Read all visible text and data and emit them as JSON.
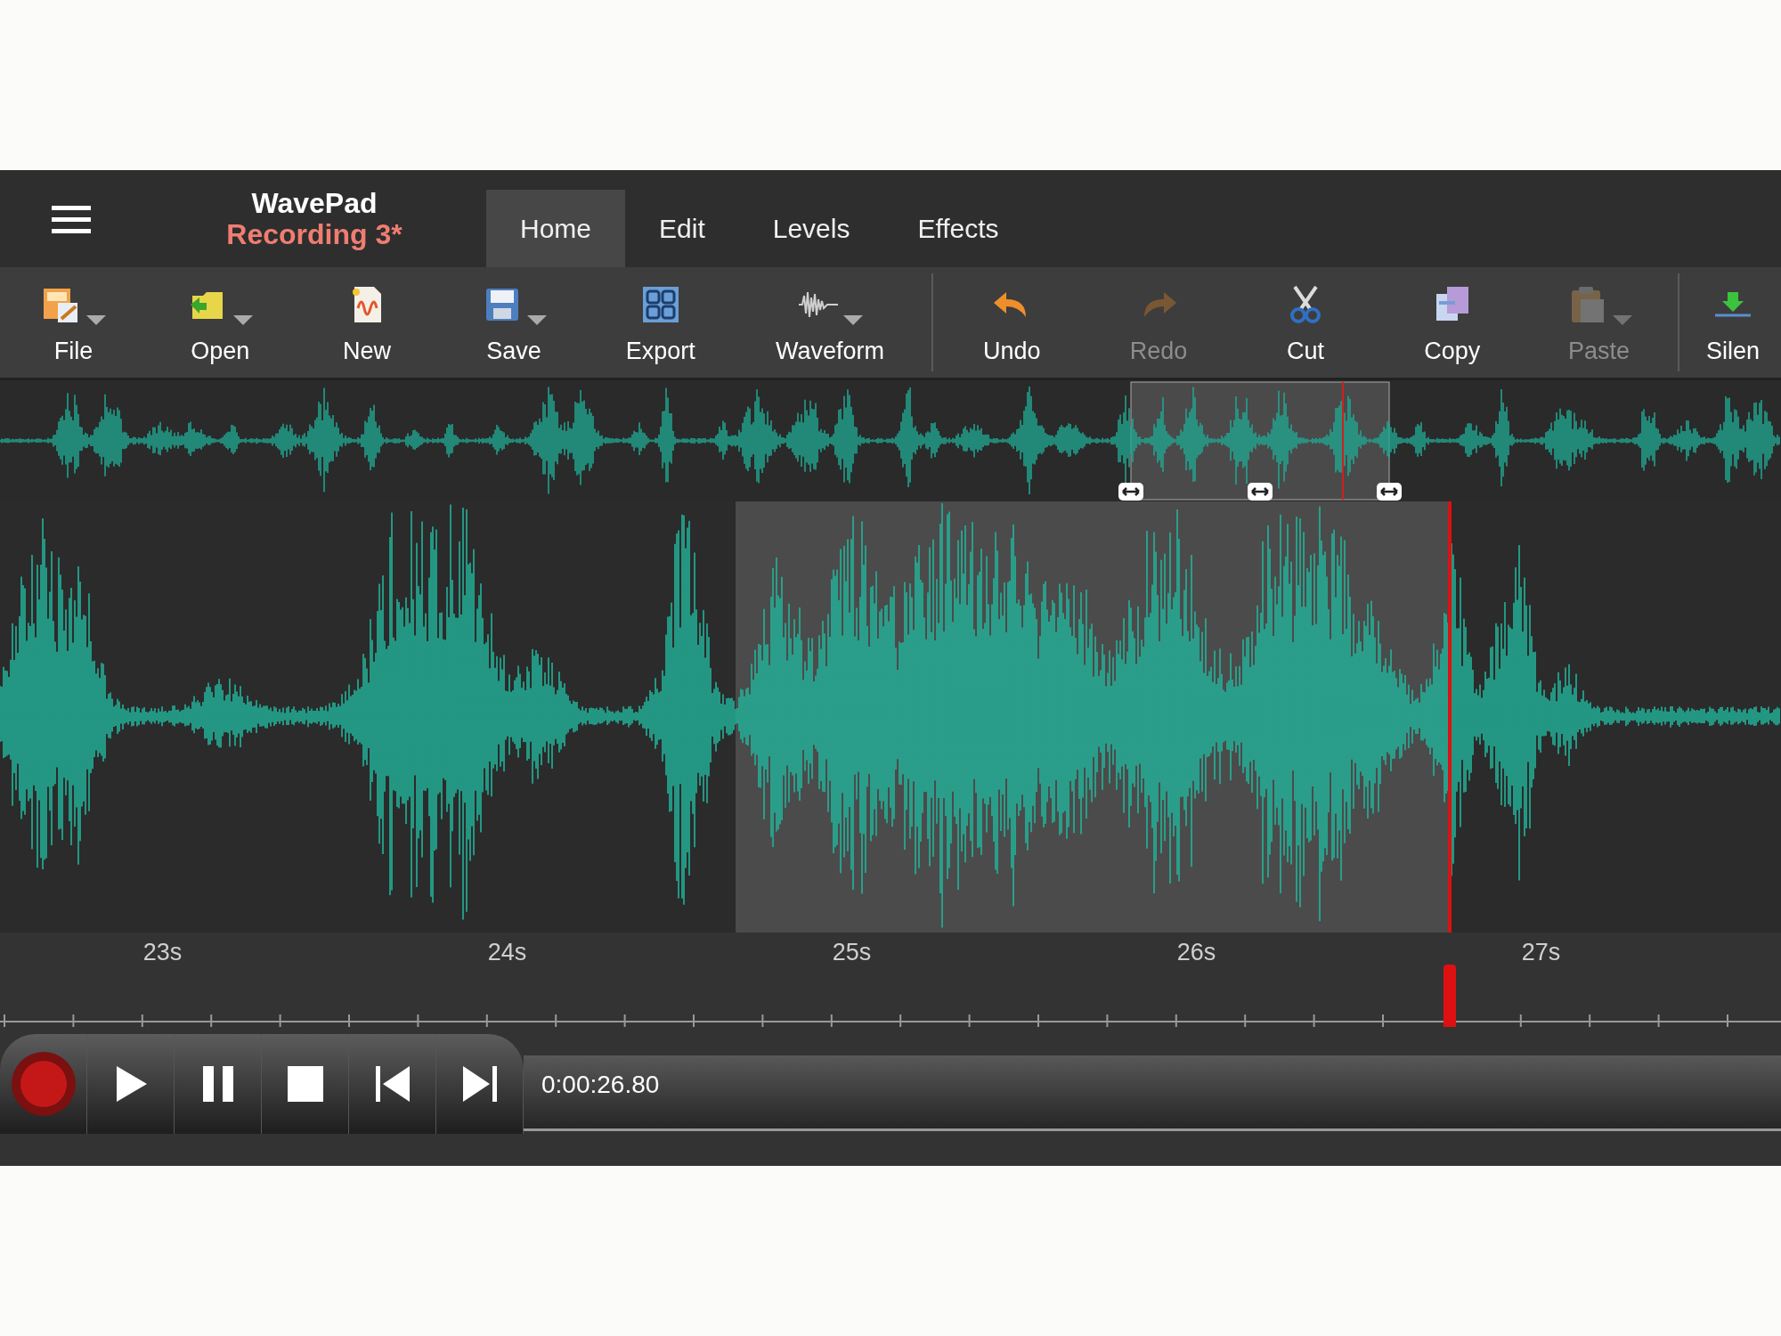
{
  "app": {
    "title": "WavePad",
    "document": "Recording 3*"
  },
  "tabs": [
    {
      "label": "Home",
      "selected": true
    },
    {
      "label": "Edit",
      "selected": false
    },
    {
      "label": "Levels",
      "selected": false
    },
    {
      "label": "Effects",
      "selected": false
    }
  ],
  "toolbar": [
    [
      {
        "label": "File",
        "dropdown": true,
        "disabled": false
      },
      {
        "label": "Open",
        "dropdown": true,
        "disabled": false
      },
      {
        "label": "New",
        "dropdown": false,
        "disabled": false
      },
      {
        "label": "Save",
        "dropdown": true,
        "disabled": false
      },
      {
        "label": "Export",
        "dropdown": false,
        "disabled": false
      },
      {
        "label": "Waveform",
        "dropdown": true,
        "disabled": false
      }
    ],
    [
      {
        "label": "Undo",
        "dropdown": false,
        "disabled": false
      },
      {
        "label": "Redo",
        "dropdown": false,
        "disabled": true
      },
      {
        "label": "Cut",
        "dropdown": false,
        "disabled": false
      },
      {
        "label": "Copy",
        "dropdown": false,
        "disabled": false
      },
      {
        "label": "Paste",
        "dropdown": true,
        "disabled": true
      }
    ],
    [
      {
        "label": "Silen",
        "dropdown": false,
        "disabled": false
      }
    ]
  ],
  "ruler": {
    "labels": [
      "23s",
      "24s",
      "25s",
      "26s",
      "27s"
    ],
    "playhead": {
      "level": 0.814
    }
  },
  "transport": {
    "time": "0:00:26.80"
  }
}
